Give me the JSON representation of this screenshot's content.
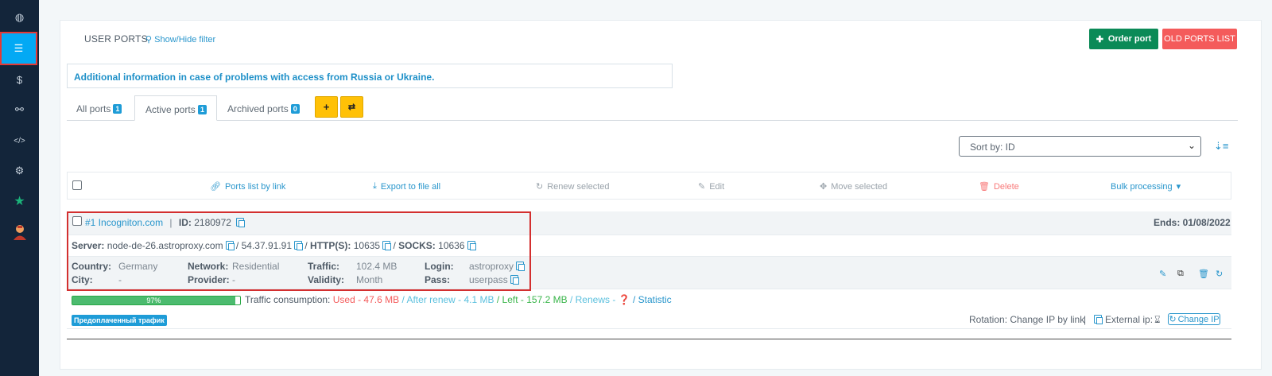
{
  "sidebar": {
    "items": [
      {
        "name": "dashboard-icon",
        "glyph": "◍"
      },
      {
        "name": "list-icon",
        "glyph": "☰"
      },
      {
        "name": "dollar-icon",
        "glyph": "$"
      },
      {
        "name": "handshake-icon",
        "glyph": "⚯"
      },
      {
        "name": "code-icon",
        "glyph": "</>"
      },
      {
        "name": "gears-icon",
        "glyph": "⚙"
      },
      {
        "name": "star-icon",
        "glyph": "★"
      },
      {
        "name": "user-avatar-icon",
        "glyph": "👤"
      }
    ]
  },
  "header": {
    "title": "USER PORTS",
    "filter_link": "Show/Hide filter",
    "order_button": "Order port",
    "old_ports_button": "OLD PORTS LIST"
  },
  "info_text": "Additional information in case of problems with access from Russia or Ukraine.",
  "tabs": [
    {
      "label": "All ports",
      "count": "1"
    },
    {
      "label": "Active ports",
      "count": "1"
    },
    {
      "label": "Archived ports",
      "count": "0"
    }
  ],
  "sort": {
    "selected": "Sort by: ID"
  },
  "bulk": {
    "ports_list": "Ports list by link",
    "export": "Export to file all",
    "renew": "Renew selected",
    "edit": "Edit",
    "move": "Move selected",
    "delete": "Delete",
    "bulk_processing": "Bulk processing"
  },
  "port": {
    "number_name": "#1 Incogniton.com",
    "separator": "|",
    "id_label": "ID:",
    "id_value": "2180972",
    "ends": "Ends: 01/08/2022",
    "server_label": "Server:",
    "server_value": "node-de-26.astroproxy.com",
    "ip": "54.37.91.91",
    "http_label": "HTTP(S):",
    "http_value": "10635",
    "socks_label": "SOCKS:",
    "socks_value": "10636",
    "slash": "/",
    "country_label": "Country:",
    "country_value": "Germany",
    "city_label": "City:",
    "city_value": "-",
    "network_label": "Network:",
    "network_value": "Residential",
    "provider_label": "Provider:",
    "provider_value": "-",
    "traffic_label": "Traffic:",
    "traffic_value": "102.4 MB",
    "validity_label": "Validity:",
    "validity_value": "Month",
    "login_label": "Login:",
    "login_value": "astroproxy",
    "pass_label": "Pass:",
    "pass_value": "userpass"
  },
  "consumption": {
    "percent": "97%",
    "fraction": 0.97,
    "label": "Traffic consumption:",
    "used": "Used - 47.6 MB",
    "sep": "/",
    "after_renew": "After renew - 4.1 MB",
    "left": "Left - 157.2 MB",
    "renews": "Renews - ❓",
    "statistic": "Statistic"
  },
  "prepaid_tag": "Предоплаченный трафик",
  "rotation": {
    "text": "Rotation: Change IP by link",
    "sep": "|",
    "external": "External ip:",
    "change_ip": "Change IP"
  },
  "colors": {
    "sidebar_bg": "#13253a",
    "active_blue": "#03a9f4",
    "order_green": "#0b8a57",
    "old_red": "#f45b5b",
    "yellow": "#ffc107"
  }
}
